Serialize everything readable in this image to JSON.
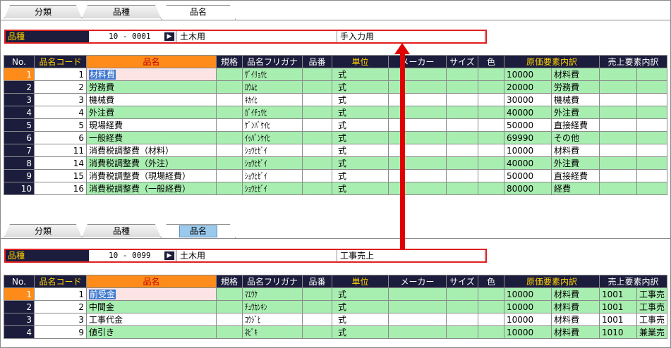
{
  "colors": {
    "header_bg": "#1c1c3c",
    "header_highlight": "#ffd200",
    "orange": "#ff8c1a",
    "green_row": "#a8eeb0",
    "red_frame": "#e02020"
  },
  "top": {
    "tabs": [
      "分類",
      "品種",
      "品名"
    ],
    "kind": {
      "label": "品種",
      "code": "10 -  0001",
      "button_icon": "arrow-right-icon",
      "name": "土木用",
      "memo": "手入力用"
    },
    "columns": [
      "No.",
      "品名コード",
      "品名",
      "規格",
      "品名フリガナ",
      "品番",
      "単位",
      "メーカー",
      "サイズ",
      "色",
      "原価要素内訳",
      "",
      "売上要素内訳",
      ""
    ],
    "rows": [
      {
        "no": "1",
        "code": "1",
        "name": "材料費",
        "kana": "ｻﾞｲﾘｮｳﾋ",
        "unit": "式",
        "cost_code": "10000",
        "cost_name": "材料費",
        "sales_code": "",
        "sales_name": ""
      },
      {
        "no": "2",
        "code": "2",
        "name": "労務費",
        "kana": "ﾛｳﾑﾋ",
        "unit": "式",
        "cost_code": "20000",
        "cost_name": "労務費",
        "sales_code": "",
        "sales_name": ""
      },
      {
        "no": "3",
        "code": "3",
        "name": "機械費",
        "kana": "ｷｶｲﾋ",
        "unit": "式",
        "cost_code": "30000",
        "cost_name": "機械費",
        "sales_code": "",
        "sales_name": ""
      },
      {
        "no": "4",
        "code": "4",
        "name": "外注費",
        "kana": "ｶﾞｲﾁｭｳﾋ",
        "unit": "式",
        "cost_code": "40000",
        "cost_name": "外注費",
        "sales_code": "",
        "sales_name": ""
      },
      {
        "no": "5",
        "code": "5",
        "name": "現場経費",
        "kana": "ｹﾞﾝﾊﾞｹｲﾋ",
        "unit": "式",
        "cost_code": "50000",
        "cost_name": "直接経費",
        "sales_code": "",
        "sales_name": ""
      },
      {
        "no": "6",
        "code": "6",
        "name": "一般経費",
        "kana": "ｲｯﾊﾟﾝｹｲﾋ",
        "unit": "式",
        "cost_code": "69990",
        "cost_name": "その他",
        "sales_code": "",
        "sales_name": ""
      },
      {
        "no": "7",
        "code": "11",
        "name": "消費税調整費（材料）",
        "kana": "ｼｮｳﾋｾﾞｲ",
        "unit": "式",
        "cost_code": "10000",
        "cost_name": "材料費",
        "sales_code": "",
        "sales_name": ""
      },
      {
        "no": "8",
        "code": "14",
        "name": "消費税調整費（外注）",
        "kana": "ｼｮｳﾋｾﾞｲ",
        "unit": "式",
        "cost_code": "40000",
        "cost_name": "外注費",
        "sales_code": "",
        "sales_name": ""
      },
      {
        "no": "9",
        "code": "15",
        "name": "消費税調整費（現場経費）",
        "kana": "ｼｮｳﾋｾﾞｲ",
        "unit": "式",
        "cost_code": "50000",
        "cost_name": "直接経費",
        "sales_code": "",
        "sales_name": ""
      },
      {
        "no": "10",
        "code": "16",
        "name": "消費税調整費（一般経費）",
        "kana": "ｼｮｳﾋｾﾞｲ",
        "unit": "式",
        "cost_code": "80000",
        "cost_name": "経費",
        "sales_code": "",
        "sales_name": ""
      }
    ]
  },
  "bottom": {
    "tabs": [
      "分類",
      "品種",
      "品名"
    ],
    "kind": {
      "label": "品種",
      "code": "10 -  0099",
      "button_icon": "arrow-right-icon",
      "name": "土木用",
      "memo": "工事売上"
    },
    "columns": [
      "No.",
      "品名コード",
      "品名",
      "規格",
      "品名フリガナ",
      "品番",
      "単位",
      "メーカー",
      "サイズ",
      "色",
      "原価要素内訳",
      "",
      "売上要素内訳",
      ""
    ],
    "rows": [
      {
        "no": "1",
        "code": "1",
        "name": "前受金",
        "kana": "ﾏｴｳｹ",
        "unit": "式",
        "cost_code": "10000",
        "cost_name": "材料費",
        "sales_code": "1001",
        "sales_name": "工事売"
      },
      {
        "no": "2",
        "code": "2",
        "name": "中間金",
        "kana": "ﾁｭｳｶﾝｷﾝ",
        "unit": "式",
        "cost_code": "10000",
        "cost_name": "材料費",
        "sales_code": "1001",
        "sales_name": "工事売"
      },
      {
        "no": "3",
        "code": "3",
        "name": "工事代金",
        "kana": "ｺｳｼﾞﾋ",
        "unit": "式",
        "cost_code": "10000",
        "cost_name": "材料費",
        "sales_code": "1001",
        "sales_name": "工事売"
      },
      {
        "no": "4",
        "code": "9",
        "name": "値引き",
        "kana": "ﾈﾋﾞｷ",
        "unit": "式",
        "cost_code": "10000",
        "cost_name": "材料費",
        "sales_code": "1010",
        "sales_name": "兼業売"
      }
    ]
  }
}
